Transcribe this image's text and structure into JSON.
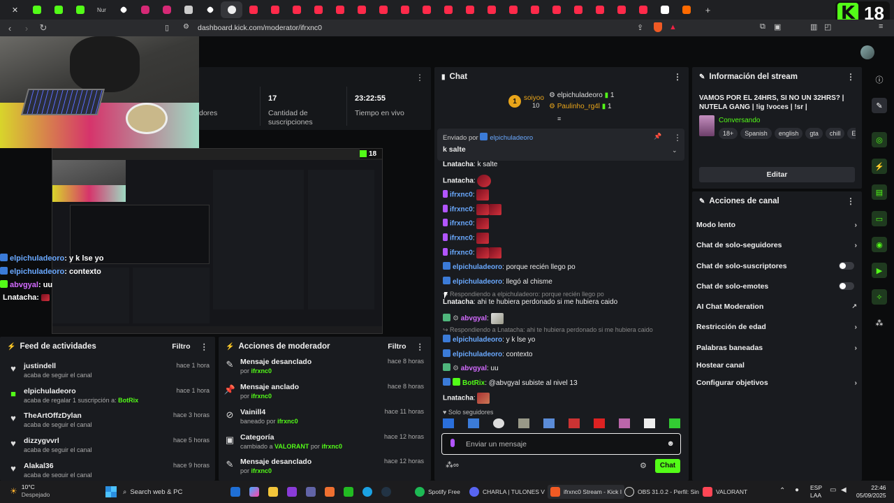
{
  "browser": {
    "tab_labels": [
      "Nur"
    ],
    "url": "dashboard.kick.com/moderator/ifrxnc0",
    "kick_count": "18"
  },
  "stats": {
    "followers_label": "dores",
    "subs_value": "17",
    "subs_label": "Cantidad de suscripciones",
    "live_value": "23:22:55",
    "live_label": "Tiempo en vivo"
  },
  "overlay_chat": [
    {
      "user": "elpichuladeoro",
      "text": ": y k lse yo"
    },
    {
      "user": "elpichuladeoro",
      "text": ": contexto"
    },
    {
      "user": "abvgyal",
      "text": ": uu"
    },
    {
      "user": "Lnatacha",
      "text": ":"
    }
  ],
  "nested_count": "18",
  "feed": {
    "title": "Feed de actividades",
    "filter": "Filtro",
    "items": [
      {
        "name": "justindell",
        "desc": "acaba de seguir el canal",
        "time": "hace 1 hora",
        "icon": "heart-icon"
      },
      {
        "name": "elpichuladeoro",
        "desc": "acaba de regalar 1 suscripción a:",
        "extra": "BotRix",
        "time": "hace 1 hora",
        "icon": "gift-icon"
      },
      {
        "name": "TheArtOffzDylan",
        "desc": "acaba de seguir el canal",
        "time": "hace 3 horas",
        "icon": "heart-icon"
      },
      {
        "name": "dizzygvvrl",
        "desc": "acaba de seguir el canal",
        "time": "hace 5 horas",
        "icon": "heart-icon"
      },
      {
        "name": "Alakal36",
        "desc": "acaba de seguir el canal",
        "time": "hace 9 horas",
        "icon": "heart-icon"
      }
    ]
  },
  "mod": {
    "title": "Acciones de moderador",
    "filter": "Filtro",
    "items": [
      {
        "name": "Mensaje desanclado",
        "by": "por",
        "user": "ifrxnc0",
        "time": "hace 8 horas"
      },
      {
        "name": "Mensaje anclado",
        "by": "por",
        "user": "ifrxnc0",
        "time": "hace 8 horas"
      },
      {
        "name": "Vainill4",
        "by": "baneado por",
        "user": "ifrxnc0",
        "time": "hace 11 horas"
      },
      {
        "name": "Categoría",
        "by": "cambiado a",
        "extra": "VALORANT",
        "by2": "por",
        "user": "ifrxnc0",
        "time": "hace 12 horas"
      },
      {
        "name": "Mensaje desanclado",
        "by": "por",
        "user": "ifrxnc0",
        "time": "hace 12 horas"
      }
    ]
  },
  "chat": {
    "title": "Chat",
    "top": {
      "gifter1": "soiyoo",
      "gifter1_count": "10",
      "user2": "elpichuladeoro",
      "user2_count": "1",
      "user3": "Paulinho_rg4l",
      "user3_count": "1"
    },
    "pinned_by": "Enviado por",
    "pinned_user": "elpichuladeoro",
    "pinned_text": "k salte",
    "messages": [
      {
        "user": "Lnatacha",
        "text": ": k salte"
      },
      {
        "user": "Lnatacha",
        "text": ":"
      },
      {
        "user": "ifrxnc0",
        "text": ":"
      },
      {
        "user": "ifrxnc0",
        "text": ":"
      },
      {
        "user": "ifrxnc0",
        "text": ":"
      },
      {
        "user": "ifrxnc0",
        "text": ":"
      },
      {
        "user": "ifrxnc0",
        "text": ":"
      },
      {
        "user": "elpichuladeoro",
        "text": ": porque recién llego po"
      },
      {
        "user": "elpichuladeoro",
        "text": ": llegó al chisme"
      },
      {
        "reply": "Respondiendo a elpichuladeoro: porque recién llego po"
      },
      {
        "user": "Lnatacha",
        "text": ": ahi te hubiera perdonado si me hubiera caido"
      },
      {
        "user": "abvgyal",
        "text": ":"
      },
      {
        "reply": "Respondiendo a Lnatacha: ahi te hubiera perdonado si me hubiera caido"
      },
      {
        "user": "elpichuladeoro",
        "text": ": y k lse yo"
      },
      {
        "user": "elpichuladeoro",
        "text": ": contexto"
      },
      {
        "user": "abvgyal",
        "text": ": uu"
      },
      {
        "user": "BotRix",
        "text": ": @abvgyal subiste al nivel 13"
      },
      {
        "user": "Lnatacha",
        "text": ":"
      }
    ],
    "mode": "Solo seguidores",
    "input_placeholder": "Enviar un mensaje",
    "send": "Chat"
  },
  "stream_info": {
    "title": "Información del stream",
    "stream_title": "VAMOS POR EL 24HRS, SI NO UN 32HRS? | NUTELA GANG | !ig !voces | !sr |",
    "category": "Conversando",
    "tags": [
      "18+",
      "Spanish",
      "english",
      "gta",
      "chill",
      "Es"
    ],
    "edit": "Editar"
  },
  "channel_actions": {
    "title": "Acciones de canal",
    "items": [
      {
        "label": "Modo lento",
        "control": "chevron"
      },
      {
        "label": "Chat de solo-seguidores",
        "control": "chevron"
      },
      {
        "label": "Chat de solo-suscriptores",
        "control": "toggle"
      },
      {
        "label": "Chat de solo-emotes",
        "control": "toggle"
      },
      {
        "label": "AI Chat Moderation",
        "control": "external"
      },
      {
        "label": "Restricción de edad",
        "control": "chevron"
      },
      {
        "label": "Palabras baneadas",
        "control": "chevron"
      },
      {
        "label": "Hostear canal",
        "control": "none"
      },
      {
        "label": "Configurar objetivos",
        "control": "chevron"
      }
    ]
  },
  "taskbar": {
    "weather_temp": "10°C",
    "weather_desc": "Despejado",
    "search": "Search web & PC",
    "apps": [
      "Spotify Free",
      "CHARLA | TULONES V",
      "ifrxnc0 Stream - Kick I",
      "OBS 31.0.2 - Perfil: Sin",
      "VALORANT"
    ],
    "lang": "ESP",
    "lang2": "LAA",
    "time": "22:46",
    "date": "05/09/2025"
  },
  "colors": {
    "accent": "#53fc18",
    "bg": "#0b0c0d",
    "panel": "#191b1f",
    "link": "#6aa9ff"
  }
}
